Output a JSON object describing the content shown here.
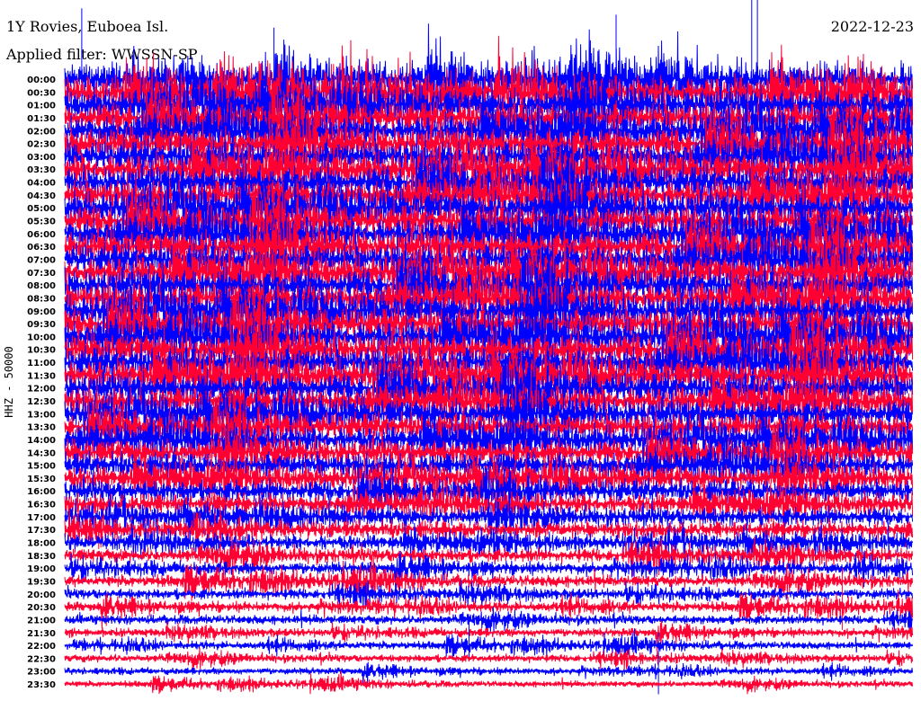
{
  "header": {
    "station": "1Y Rovies, Euboea Isl.",
    "date": "2022-12-23",
    "filter": "Applied filter: WWSSN-SP"
  },
  "chart_data": {
    "type": "line",
    "subtype": "helicorder",
    "title": "1Y Rovies, Euboea Isl.",
    "ylabel": "HHZ - 50000",
    "minutes_per_line": 30,
    "colors": [
      "#0000ff",
      "#ff0033"
    ],
    "row_labels": [
      "00:00",
      "00:30",
      "01:00",
      "01:30",
      "02:00",
      "02:30",
      "03:00",
      "03:30",
      "04:00",
      "04:30",
      "05:00",
      "05:30",
      "06:00",
      "06:30",
      "07:00",
      "07:30",
      "08:00",
      "08:30",
      "09:00",
      "09:30",
      "10:00",
      "10:30",
      "11:00",
      "11:30",
      "12:00",
      "12:30",
      "13:00",
      "13:30",
      "14:00",
      "14:30",
      "15:00",
      "15:30",
      "16:00",
      "16:30",
      "17:00",
      "17:30",
      "18:00",
      "18:30",
      "19:00",
      "19:30",
      "20:00",
      "20:30",
      "21:00",
      "21:30",
      "22:00",
      "22:30",
      "23:00",
      "23:30"
    ],
    "row_noise_level": [
      1.0,
      1.0,
      1.0,
      1.0,
      1.0,
      1.0,
      1.0,
      1.0,
      1.0,
      1.0,
      1.0,
      1.0,
      1.0,
      1.0,
      1.0,
      1.0,
      1.0,
      1.0,
      1.0,
      1.0,
      1.0,
      1.0,
      1.0,
      1.0,
      0.95,
      0.9,
      0.9,
      0.85,
      0.85,
      0.8,
      0.8,
      0.75,
      0.7,
      0.65,
      0.6,
      0.55,
      0.5,
      0.45,
      0.4,
      0.38,
      0.35,
      0.32,
      0.3,
      0.28,
      0.25,
      0.25,
      0.22,
      0.2
    ],
    "spikes": [
      {
        "row": 0,
        "minute": 0.6,
        "amplitude": 5.5
      },
      {
        "row": 0,
        "minute": 7.4,
        "amplitude": 4.0
      },
      {
        "row": 0,
        "minute": 19.5,
        "amplitude": 5.0
      },
      {
        "row": 0,
        "minute": 24.3,
        "amplitude": 6.5
      },
      {
        "row": 0,
        "minute": 24.5,
        "amplitude": 6.5
      },
      {
        "row": 46,
        "minute": 21.0,
        "amplitude": 3.0
      },
      {
        "row": 41,
        "minute": 27.5,
        "amplitude": 3.0
      },
      {
        "row": 44,
        "minute": 14.3,
        "amplitude": 2.0
      }
    ]
  }
}
